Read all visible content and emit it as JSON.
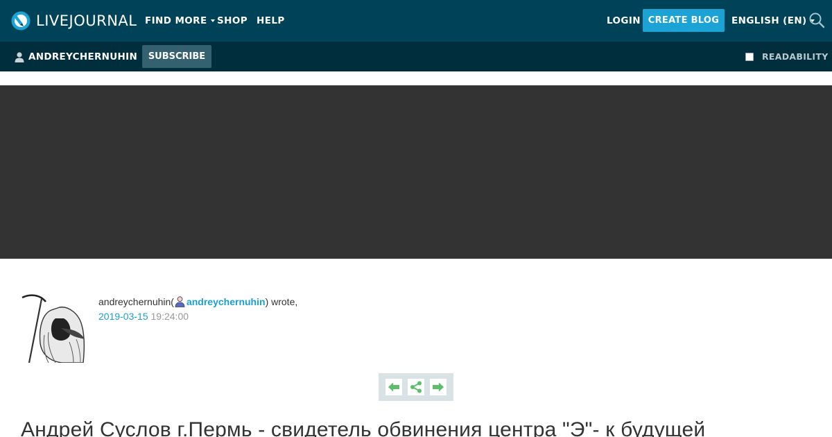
{
  "header": {
    "logo_text": "LIVEJOURNAL",
    "nav": {
      "find_more": "FIND MORE",
      "shop": "SHOP",
      "help": "HELP",
      "login": "LOGIN",
      "create_blog": "CREATE BLOG",
      "language": "ENGLISH (EN)"
    }
  },
  "userbar": {
    "journal_user": "ANDREYCHERNUHIN",
    "subscribe": "SUBSCRIBE",
    "readability": "READABILITY",
    "readability_checked": false
  },
  "entry": {
    "author_name": "andreychernuhin",
    "author_ljuser": "andreychernuhin",
    "open_paren": " (",
    "wrote": ") wrote,",
    "date": "2019-03-15",
    "time": "19:24:00",
    "title": "Андрей Суслов г.Пермь - свидетель обвинения центра \"Э\"- к будущей"
  },
  "colors": {
    "topbar_bg": "#004359",
    "userbar_bg": "#002e3d",
    "accent": "#1aa3d4",
    "banner_bg": "#333333",
    "nav_arrow_green": "#5bbf6a"
  }
}
